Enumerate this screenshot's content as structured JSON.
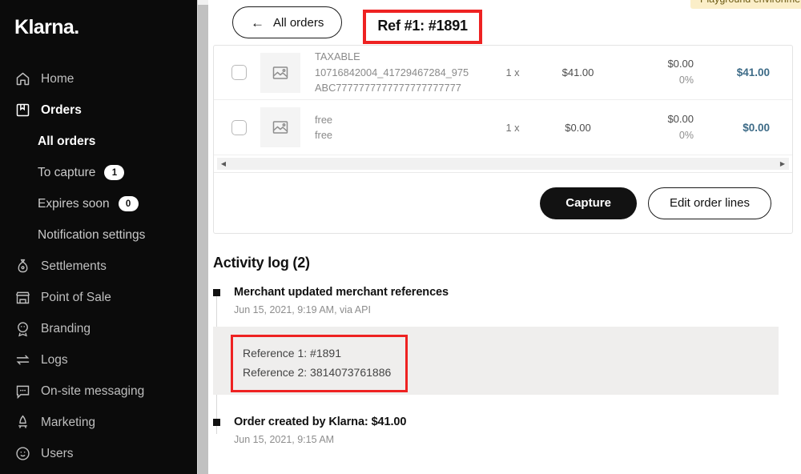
{
  "sidebar": {
    "brand": "Klarna.",
    "items": [
      {
        "label": "Home",
        "icon": "home-icon"
      },
      {
        "label": "Orders",
        "icon": "orders-box-icon"
      },
      {
        "label": "Settlements",
        "icon": "money-bag-icon"
      },
      {
        "label": "Point of Sale",
        "icon": "storefront-icon"
      },
      {
        "label": "Branding",
        "icon": "branding-badge-icon"
      },
      {
        "label": "Logs",
        "icon": "transfer-arrows-icon"
      },
      {
        "label": "On-site messaging",
        "icon": "chat-bubble-icon"
      },
      {
        "label": "Marketing",
        "icon": "megaphone-icon"
      },
      {
        "label": "Users",
        "icon": "smiley-face-icon"
      }
    ],
    "orders_sub": [
      {
        "label": "All orders",
        "badge": null
      },
      {
        "label": "To capture",
        "badge": "1"
      },
      {
        "label": "Expires soon",
        "badge": "0"
      },
      {
        "label": "Notification settings",
        "badge": null
      }
    ]
  },
  "topbar": {
    "back_label": "All orders",
    "back_arrow": "←",
    "ref_title": "Ref #1: #1891",
    "env_badge": "Playground environment (us)"
  },
  "order_lines": {
    "rows": [
      {
        "name": "TAXABLE",
        "ref1": "10716842004_41729467284_975",
        "ref2": "ABC7777777777777777777777",
        "qty": "1 x",
        "price": "$41.00",
        "tax": "$0.00",
        "tax_pct": "0%",
        "total": "$41.00"
      },
      {
        "name": "free",
        "ref1": "free",
        "ref2": "",
        "qty": "1 x",
        "price": "$0.00",
        "tax": "$0.00",
        "tax_pct": "0%",
        "total": "$0.00"
      }
    ],
    "capture_label": "Capture",
    "edit_label": "Edit order lines"
  },
  "activity": {
    "title": "Activity log (2)",
    "entries": [
      {
        "headline": "Merchant updated merchant references",
        "timestamp": "Jun 15, 2021, 9:19 AM, via API",
        "reference_1": "Reference 1: #1891",
        "reference_2": "Reference 2: 3814073761886"
      },
      {
        "headline": "Order created by Klarna: $41.00",
        "timestamp": "Jun 15, 2021, 9:15 AM"
      }
    ]
  },
  "colors": {
    "sidebar_bg": "#0b0b0b",
    "highlight_red": "#ee2222",
    "accent_dark": "#121212",
    "total_blue": "#3d6b87",
    "env_badge_bg": "#fbeec8"
  }
}
